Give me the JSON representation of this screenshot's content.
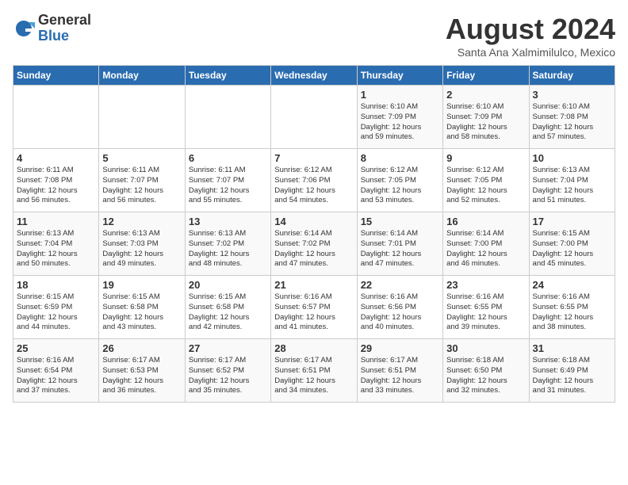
{
  "header": {
    "logo_general": "General",
    "logo_blue": "Blue",
    "title": "August 2024",
    "location": "Santa Ana Xalmimilulco, Mexico"
  },
  "days_of_week": [
    "Sunday",
    "Monday",
    "Tuesday",
    "Wednesday",
    "Thursday",
    "Friday",
    "Saturday"
  ],
  "weeks": [
    [
      {
        "day": "",
        "info": ""
      },
      {
        "day": "",
        "info": ""
      },
      {
        "day": "",
        "info": ""
      },
      {
        "day": "",
        "info": ""
      },
      {
        "day": "1",
        "info": "Sunrise: 6:10 AM\nSunset: 7:09 PM\nDaylight: 12 hours\nand 59 minutes."
      },
      {
        "day": "2",
        "info": "Sunrise: 6:10 AM\nSunset: 7:09 PM\nDaylight: 12 hours\nand 58 minutes."
      },
      {
        "day": "3",
        "info": "Sunrise: 6:10 AM\nSunset: 7:08 PM\nDaylight: 12 hours\nand 57 minutes."
      }
    ],
    [
      {
        "day": "4",
        "info": "Sunrise: 6:11 AM\nSunset: 7:08 PM\nDaylight: 12 hours\nand 56 minutes."
      },
      {
        "day": "5",
        "info": "Sunrise: 6:11 AM\nSunset: 7:07 PM\nDaylight: 12 hours\nand 56 minutes."
      },
      {
        "day": "6",
        "info": "Sunrise: 6:11 AM\nSunset: 7:07 PM\nDaylight: 12 hours\nand 55 minutes."
      },
      {
        "day": "7",
        "info": "Sunrise: 6:12 AM\nSunset: 7:06 PM\nDaylight: 12 hours\nand 54 minutes."
      },
      {
        "day": "8",
        "info": "Sunrise: 6:12 AM\nSunset: 7:05 PM\nDaylight: 12 hours\nand 53 minutes."
      },
      {
        "day": "9",
        "info": "Sunrise: 6:12 AM\nSunset: 7:05 PM\nDaylight: 12 hours\nand 52 minutes."
      },
      {
        "day": "10",
        "info": "Sunrise: 6:13 AM\nSunset: 7:04 PM\nDaylight: 12 hours\nand 51 minutes."
      }
    ],
    [
      {
        "day": "11",
        "info": "Sunrise: 6:13 AM\nSunset: 7:04 PM\nDaylight: 12 hours\nand 50 minutes."
      },
      {
        "day": "12",
        "info": "Sunrise: 6:13 AM\nSunset: 7:03 PM\nDaylight: 12 hours\nand 49 minutes."
      },
      {
        "day": "13",
        "info": "Sunrise: 6:13 AM\nSunset: 7:02 PM\nDaylight: 12 hours\nand 48 minutes."
      },
      {
        "day": "14",
        "info": "Sunrise: 6:14 AM\nSunset: 7:02 PM\nDaylight: 12 hours\nand 47 minutes."
      },
      {
        "day": "15",
        "info": "Sunrise: 6:14 AM\nSunset: 7:01 PM\nDaylight: 12 hours\nand 47 minutes."
      },
      {
        "day": "16",
        "info": "Sunrise: 6:14 AM\nSunset: 7:00 PM\nDaylight: 12 hours\nand 46 minutes."
      },
      {
        "day": "17",
        "info": "Sunrise: 6:15 AM\nSunset: 7:00 PM\nDaylight: 12 hours\nand 45 minutes."
      }
    ],
    [
      {
        "day": "18",
        "info": "Sunrise: 6:15 AM\nSunset: 6:59 PM\nDaylight: 12 hours\nand 44 minutes."
      },
      {
        "day": "19",
        "info": "Sunrise: 6:15 AM\nSunset: 6:58 PM\nDaylight: 12 hours\nand 43 minutes."
      },
      {
        "day": "20",
        "info": "Sunrise: 6:15 AM\nSunset: 6:58 PM\nDaylight: 12 hours\nand 42 minutes."
      },
      {
        "day": "21",
        "info": "Sunrise: 6:16 AM\nSunset: 6:57 PM\nDaylight: 12 hours\nand 41 minutes."
      },
      {
        "day": "22",
        "info": "Sunrise: 6:16 AM\nSunset: 6:56 PM\nDaylight: 12 hours\nand 40 minutes."
      },
      {
        "day": "23",
        "info": "Sunrise: 6:16 AM\nSunset: 6:55 PM\nDaylight: 12 hours\nand 39 minutes."
      },
      {
        "day": "24",
        "info": "Sunrise: 6:16 AM\nSunset: 6:55 PM\nDaylight: 12 hours\nand 38 minutes."
      }
    ],
    [
      {
        "day": "25",
        "info": "Sunrise: 6:16 AM\nSunset: 6:54 PM\nDaylight: 12 hours\nand 37 minutes."
      },
      {
        "day": "26",
        "info": "Sunrise: 6:17 AM\nSunset: 6:53 PM\nDaylight: 12 hours\nand 36 minutes."
      },
      {
        "day": "27",
        "info": "Sunrise: 6:17 AM\nSunset: 6:52 PM\nDaylight: 12 hours\nand 35 minutes."
      },
      {
        "day": "28",
        "info": "Sunrise: 6:17 AM\nSunset: 6:51 PM\nDaylight: 12 hours\nand 34 minutes."
      },
      {
        "day": "29",
        "info": "Sunrise: 6:17 AM\nSunset: 6:51 PM\nDaylight: 12 hours\nand 33 minutes."
      },
      {
        "day": "30",
        "info": "Sunrise: 6:18 AM\nSunset: 6:50 PM\nDaylight: 12 hours\nand 32 minutes."
      },
      {
        "day": "31",
        "info": "Sunrise: 6:18 AM\nSunset: 6:49 PM\nDaylight: 12 hours\nand 31 minutes."
      }
    ]
  ]
}
